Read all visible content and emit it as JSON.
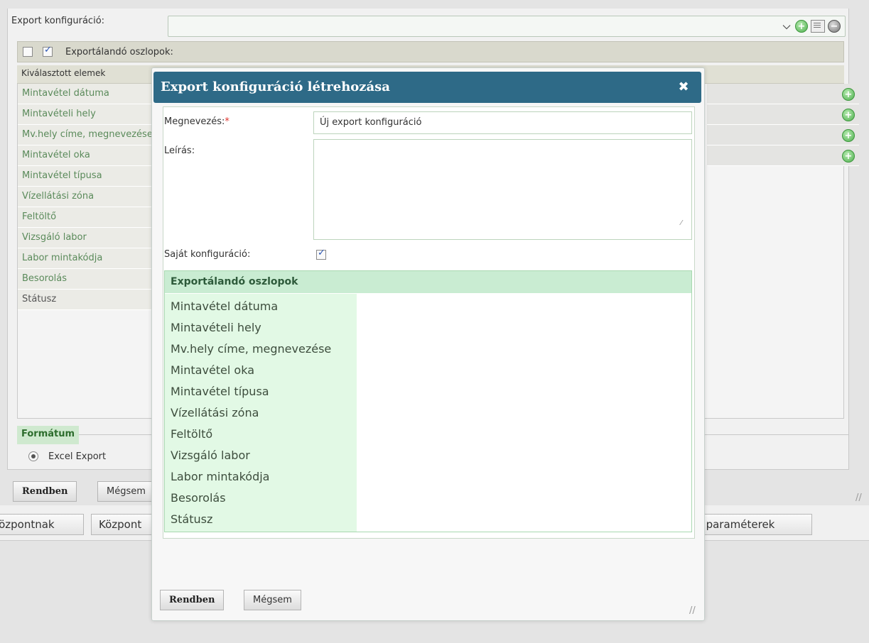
{
  "background": {
    "export_config_label": "Export konfiguráció:",
    "columns_bar_label": "Exportálandó oszlopok:",
    "selected_header": "Kiválasztott elemek",
    "rows": [
      "Mintavétel dátuma",
      "Mintavételi hely",
      "Mv.hely címe, megnevezése",
      "Mintavétel oka",
      "Mintavétel típusa",
      "Vízellátási zóna",
      "Feltöltő",
      "Vizsgáló labor",
      "Labor mintakódja",
      "Besorolás",
      "Státusz"
    ],
    "format_legend": "Formátum",
    "format_option": "Excel Export",
    "ok_button": "Rendben",
    "cancel_button": "Mégsem",
    "tabs": [
      "Központnak",
      "Központ",
      "s paraméterek"
    ]
  },
  "dialog": {
    "title": "Export konfiguráció létrehozása",
    "close_glyph": "✖",
    "name_label": "Megnevezés:",
    "required_mark": "*",
    "name_value": "Új export konfiguráció",
    "description_label": "Leírás:",
    "own_config_label": "Saját konfiguráció:",
    "own_config_checked": true,
    "columns_header": "Exportálandó oszlopok",
    "columns": [
      "Mintavétel dátuma",
      "Mintavételi hely",
      "Mv.hely címe, megnevezése",
      "Mintavétel oka",
      "Mintavétel típusa",
      "Vízellátási zóna",
      "Feltöltő",
      "Vizsgáló labor",
      "Labor mintakódja",
      "Besorolás",
      "Státusz"
    ],
    "ok_button": "Rendben",
    "cancel_button": "Mégsem"
  },
  "colors": {
    "title_bar": "#2e6a87",
    "accent_green": "#4fb14f",
    "column_header_bg": "#c9ecd2",
    "column_list_bg": "#e2f9e5"
  },
  "icons": [
    "chevron-down-icon",
    "add-icon",
    "edit-icon",
    "remove-icon",
    "close-icon",
    "resize-grip-icon"
  ]
}
